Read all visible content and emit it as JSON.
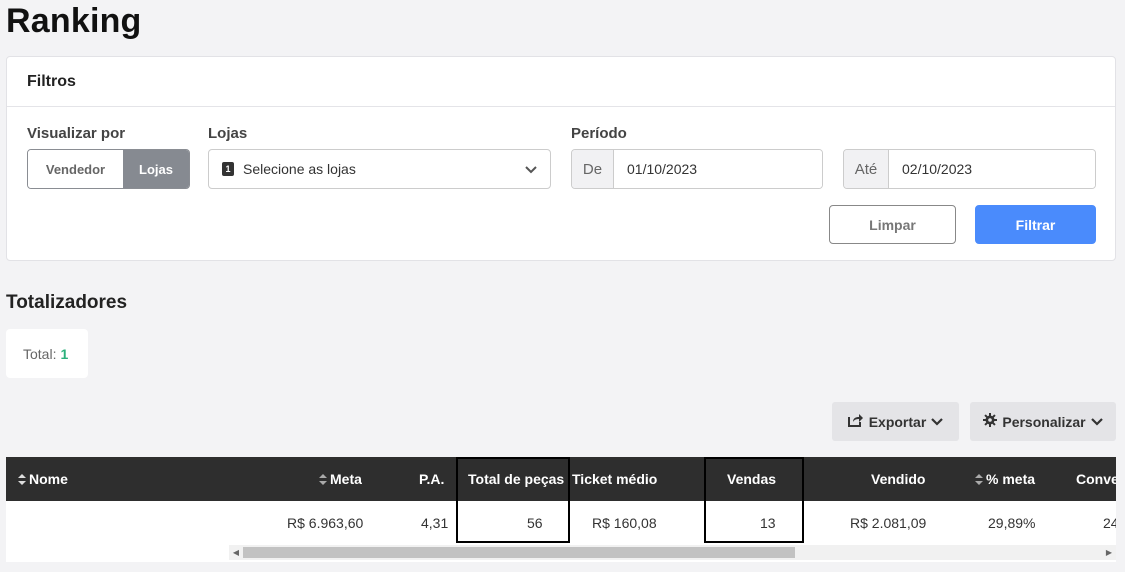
{
  "page": {
    "title": "Ranking"
  },
  "filters": {
    "title": "Filtros",
    "view_by": {
      "label": "Visualizar por",
      "options": [
        "Vendedor",
        "Lojas"
      ],
      "selected": "Lojas"
    },
    "stores": {
      "label": "Lojas",
      "badge": "1",
      "placeholder": "Selecione as lojas"
    },
    "period": {
      "label": "Período",
      "from_prefix": "De",
      "from_value": "01/10/2023",
      "to_prefix": "Até",
      "to_value": "02/10/2023"
    },
    "clear_label": "Limpar",
    "filter_label": "Filtrar"
  },
  "totals": {
    "title": "Totalizadores",
    "label": "Total:",
    "value": "1"
  },
  "actions": {
    "export_label": "Exportar",
    "customize_label": "Personalizar"
  },
  "table": {
    "columns": [
      "Nome",
      "Meta",
      "P.A.",
      "Total de peças",
      "Ticket médio",
      "Vendas",
      "Vendido",
      "% meta",
      "Conve"
    ],
    "rows": [
      [
        "",
        "R$ 6.963,60",
        "4,31",
        "56",
        "R$ 160,08",
        "13",
        "R$ 2.081,09",
        "29,89%",
        "24"
      ]
    ]
  },
  "colors": {
    "accent": "#4a8bfc",
    "total_value": "#2bb07b",
    "header_bg": "#2e2e2e"
  }
}
